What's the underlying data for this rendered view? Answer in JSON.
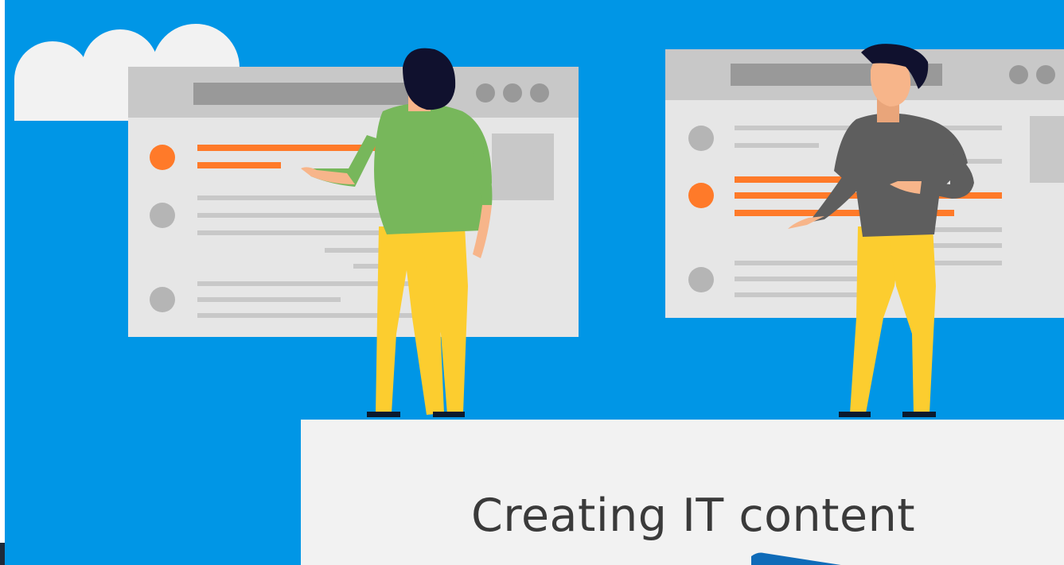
{
  "caption": {
    "title": "Creating IT content"
  },
  "colors": {
    "background": "#0096e6",
    "window": "#e6e6e6",
    "window_header": "#c8c8c8",
    "accent_orange": "#ff7a29",
    "shirt_green": "#77b75b",
    "shirt_gray": "#5e5e5e",
    "pants_yellow": "#fccd2f",
    "hair": "#10112e",
    "skin": "#f7b58a",
    "card": "#f2f2f2"
  },
  "illustration": {
    "left_figure": "person-green-shirt-icon",
    "right_figure": "person-gray-shirt-icon",
    "cloud": "cloud-icon",
    "arrow": "arrow-icon"
  }
}
